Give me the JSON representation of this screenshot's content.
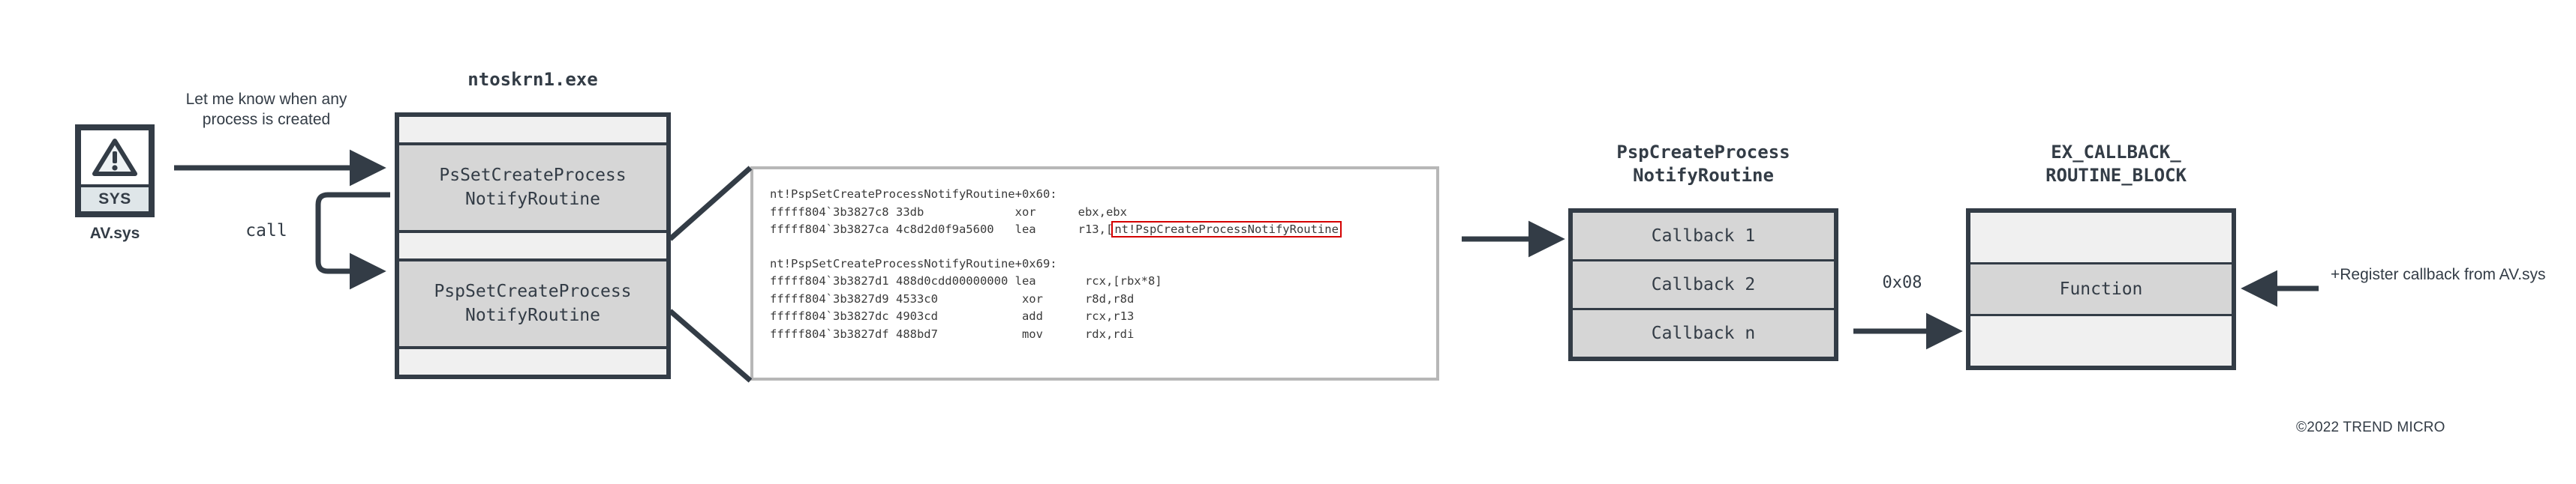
{
  "driver": {
    "icon_name": "warning-triangle-icon",
    "badge": "SYS",
    "label": "AV.sys"
  },
  "annotations": {
    "request": "Let me know when any process is created",
    "call": "call",
    "offset": "0x08",
    "register_callback": "+Register callback from AV.sys"
  },
  "ntoskrnl": {
    "title": "ntoskrn1.exe",
    "rows": [
      "PsSetCreateProcess\nNotifyRoutine",
      "PspSetCreateProcess\nNotifyRoutine"
    ]
  },
  "disassembly": {
    "blocks": [
      {
        "header": "nt!PspSetCreateProcessNotifyRoutine+0x60:",
        "lines": [
          {
            "address": "fffff804`3b3827c8",
            "bytes": "33db",
            "mnemonic": "xor",
            "operands": "ebx,ebx",
            "highlight": null
          },
          {
            "address": "fffff804`3b3827ca",
            "bytes": "4c8d2d0f9a5600",
            "mnemonic": "lea",
            "operands": "r13,[",
            "highlight": "nt!PspCreateProcessNotifyRoutine"
          }
        ]
      },
      {
        "header": "nt!PspSetCreateProcessNotifyRoutine+0x69:",
        "lines": [
          {
            "address": "fffff804`3b3827d1",
            "bytes": "488d0cdd00000000",
            "mnemonic": "lea",
            "operands": "rcx,[rbx*8]",
            "highlight": null
          },
          {
            "address": "fffff804`3b3827d9",
            "bytes": "4533c0",
            "mnemonic": "xor",
            "operands": "r8d,r8d",
            "highlight": null
          },
          {
            "address": "fffff804`3b3827dc",
            "bytes": "4903cd",
            "mnemonic": "add",
            "operands": "rcx,r13",
            "highlight": null
          },
          {
            "address": "fffff804`3b3827df",
            "bytes": "488bd7",
            "mnemonic": "mov",
            "operands": "rdx,rdi",
            "highlight": null
          }
        ]
      }
    ]
  },
  "callback_table": {
    "title": "PspCreateProcess\nNotifyRoutine",
    "rows": [
      "Callback 1",
      "Callback 2",
      "Callback n"
    ]
  },
  "callback_block": {
    "title": "EX_CALLBACK_\nROUTINE_BLOCK",
    "rows": [
      "",
      "Function",
      ""
    ]
  },
  "footer": {
    "copyright": "©2022 TREND MICRO"
  },
  "colors": {
    "ink": "#333c46",
    "fill_dark": "#d6d6d6",
    "fill_light": "#f0f0f0",
    "highlight": "#d40000",
    "panel_border": "#b7b7b7"
  }
}
